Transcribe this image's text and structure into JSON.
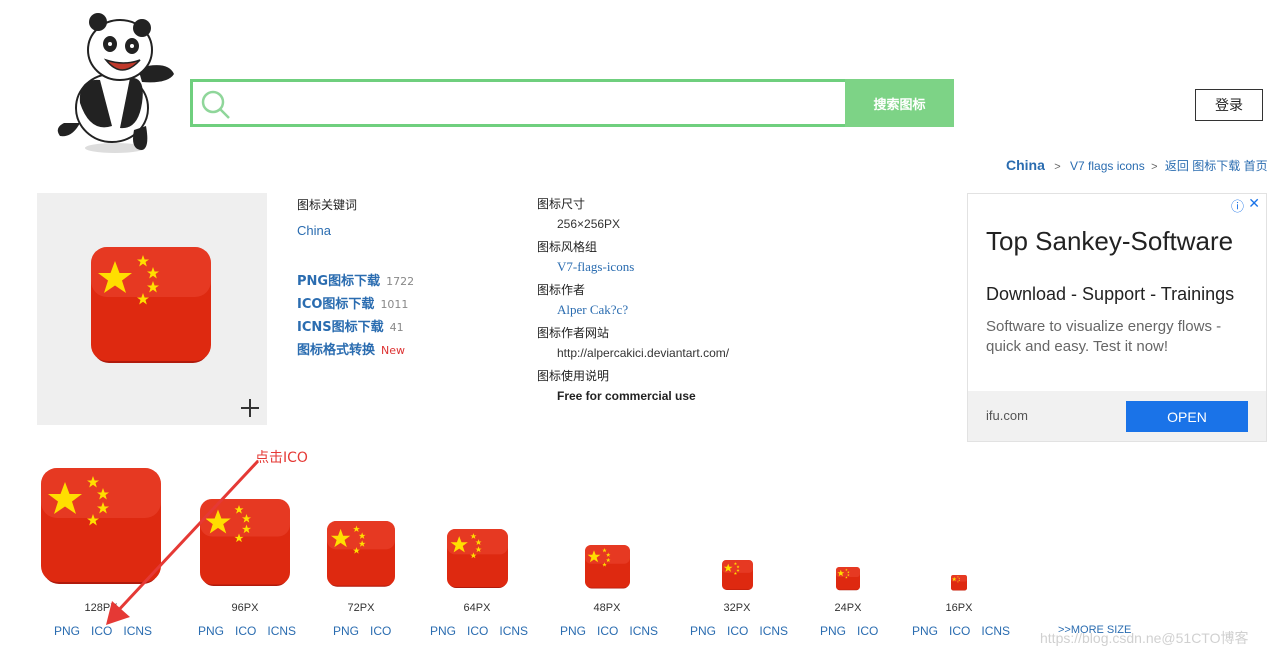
{
  "header": {
    "search_button": "搜索图标",
    "search_value": "",
    "login_button": "登录"
  },
  "breadcrumb": {
    "current": "China",
    "set": "V7 flags icons",
    "back": "返回",
    "downloads": "图标下载",
    "home": "首页"
  },
  "info": {
    "keywords_label": "图标关键词",
    "keyword": "China",
    "downloads": [
      {
        "label": "PNG图标下载",
        "count": "1722"
      },
      {
        "label": "ICO图标下载",
        "count": "1011"
      },
      {
        "label": "ICNS图标下载",
        "count": "41"
      }
    ],
    "convert_label": "图标格式转换",
    "convert_badge": "New",
    "size_label": "图标尺寸",
    "size_value": "256×256PX",
    "style_label": "图标风格组",
    "style_value": "V7-flags-icons",
    "author_label": "图标作者",
    "author_value": "Alper Cak?c?",
    "site_label": "图标作者网站",
    "site_value": "http://alpercakici.deviantart.com/",
    "usage_label": "图标使用说明",
    "usage_value": "Free for commercial use"
  },
  "ad": {
    "title": "Top Sankey-Software",
    "subtitle": "Download - Support - Trainings",
    "body": "Software to visualize energy flows - quick and easy. Test it now!",
    "domain": "ifu.com",
    "button": "OPEN"
  },
  "sizes": [
    {
      "label": "128PX",
      "formats": [
        "PNG",
        "ICO",
        "ICNS"
      ]
    },
    {
      "label": "96PX",
      "formats": [
        "PNG",
        "ICO",
        "ICNS"
      ]
    },
    {
      "label": "72PX",
      "formats": [
        "PNG",
        "ICO"
      ]
    },
    {
      "label": "64PX",
      "formats": [
        "PNG",
        "ICO",
        "ICNS"
      ]
    },
    {
      "label": "48PX",
      "formats": [
        "PNG",
        "ICO",
        "ICNS"
      ]
    },
    {
      "label": "32PX",
      "formats": [
        "PNG",
        "ICO",
        "ICNS"
      ]
    },
    {
      "label": "24PX",
      "formats": [
        "PNG",
        "ICO"
      ]
    },
    {
      "label": "16PX",
      "formats": [
        "PNG",
        "ICO",
        "ICNS"
      ]
    }
  ],
  "more_size": ">>MORE SIZE",
  "annotation": "点击ICO",
  "watermark": "https://blog.csdn.ne@51CTO博客",
  "colors": {
    "accent_green": "#7dd386",
    "link_blue": "#2a6cb0",
    "flag_red": "#de2910",
    "star_yellow": "#ffde00"
  }
}
